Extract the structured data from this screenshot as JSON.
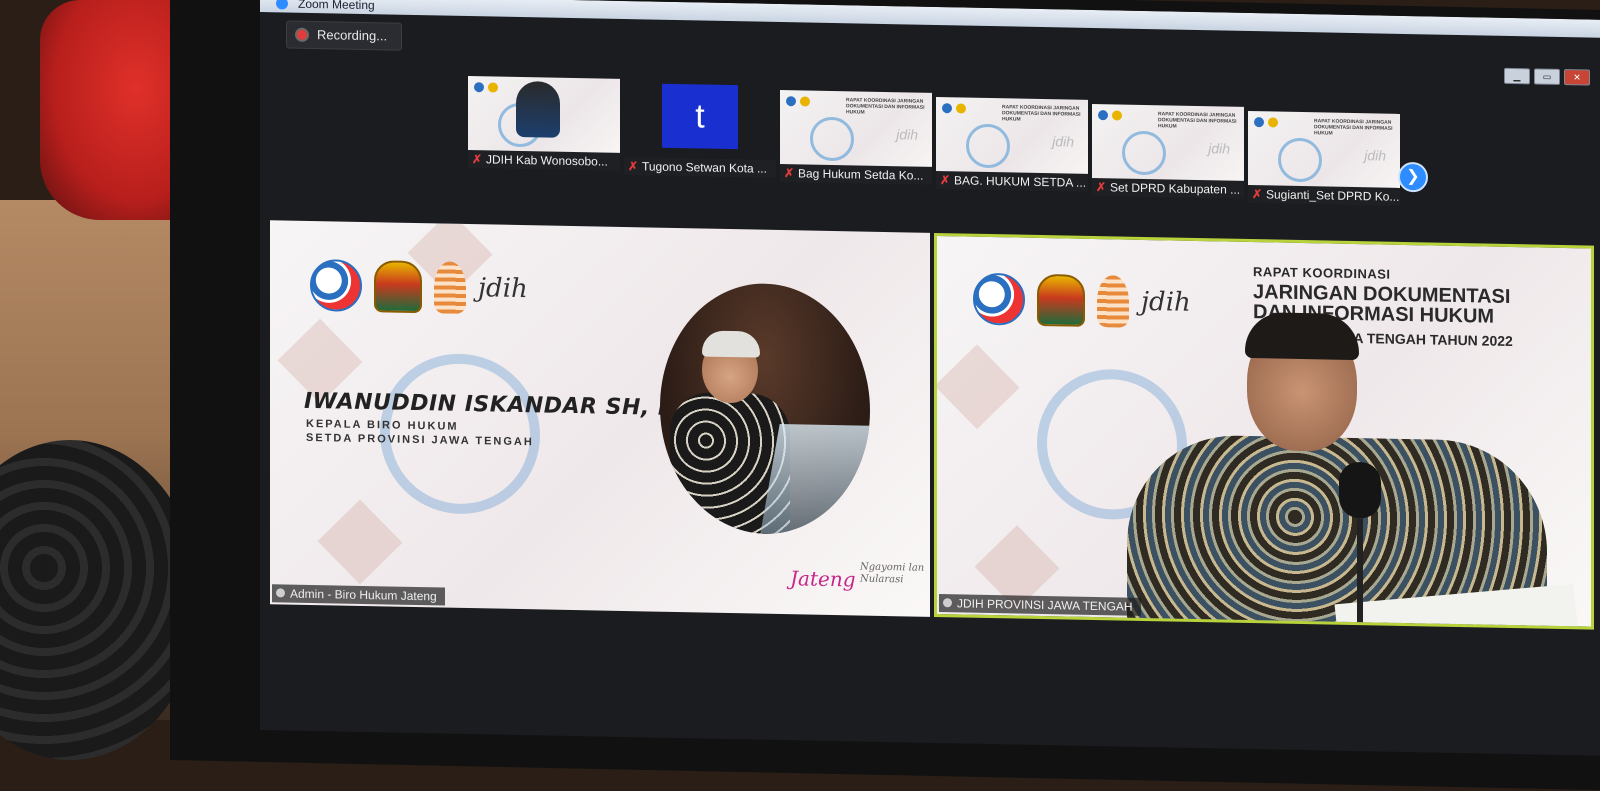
{
  "window": {
    "title": "Zoom Meeting"
  },
  "recording": {
    "label": "Recording..."
  },
  "thumbnails": [
    {
      "name": "JDIH Kab Wonosobo...",
      "muted": true
    },
    {
      "name": "Tugono Setwan Kota ...",
      "muted": true,
      "avatar_letter": "t"
    },
    {
      "name": "Bag Hukum Setda Ko...",
      "muted": true
    },
    {
      "name": "BAG. HUKUM SETDA ...",
      "muted": true
    },
    {
      "name": "Set DPRD Kabupaten ...",
      "muted": true
    },
    {
      "name": "Sugianti_Set DPRD Ko...",
      "muted": true
    }
  ],
  "slide_thumb_text": "RAPAT KOORDINASI JARINGAN DOKUMENTASI DAN INFORMASI HUKUM",
  "tiles": {
    "left": {
      "speaker_name": "IWANUDDIN ISKANDAR SH, M.HUM",
      "speaker_role_line1": "KEPALA BIRO HUKUM",
      "speaker_role_line2": "SETDA PROVINSI JAWA TENGAH",
      "jdih_logo": "jdih",
      "jateng_sign": "Jateng",
      "tagline": "Ngayomi lan Nularasi",
      "label": "Admin - Biro Hukum Jateng"
    },
    "right": {
      "event_small": "RAPAT KOORDINASI",
      "event_line1": "JARINGAN DOKUMENTASI",
      "event_line2": "DAN INFORMASI HUKUM",
      "event_line3": "PROVINSI JAWA TENGAH TAHUN 2022",
      "jdih_logo": "jdih",
      "label": "JDIH PROVINSI JAWA TENGAH"
    }
  },
  "icons": {
    "next_page": "chevron-right-icon",
    "muted": "mic-off-icon",
    "recording": "record-dot-icon"
  },
  "colors": {
    "zoom_blue": "#2d8cff",
    "active_speaker_border": "#b8d23c",
    "mute_red": "#e23b3b"
  }
}
